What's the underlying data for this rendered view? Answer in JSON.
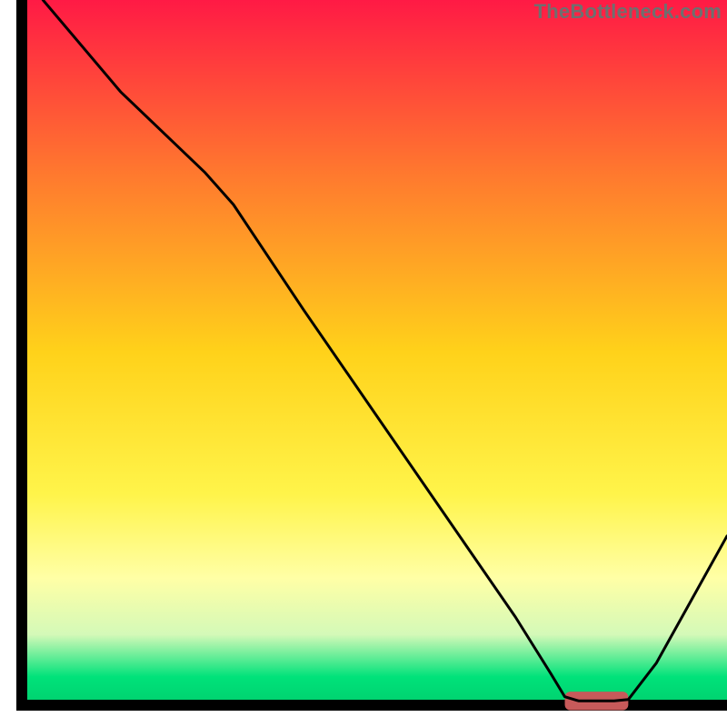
{
  "attribution": "TheBottleneck.com",
  "chart_data": {
    "type": "line",
    "title": "",
    "xlabel": "",
    "ylabel": "",
    "xlim": [
      0,
      100
    ],
    "ylim": [
      0,
      100
    ],
    "background_gradient": {
      "type": "vertical",
      "stops": [
        {
          "pos": 0.0,
          "color": "#ff1a45"
        },
        {
          "pos": 0.25,
          "color": "#ff7a2e"
        },
        {
          "pos": 0.5,
          "color": "#ffd21a"
        },
        {
          "pos": 0.7,
          "color": "#fff44a"
        },
        {
          "pos": 0.82,
          "color": "#ffffa6"
        },
        {
          "pos": 0.9,
          "color": "#d4f9b8"
        },
        {
          "pos": 0.96,
          "color": "#00e27a"
        },
        {
          "pos": 1.0,
          "color": "#00d06e"
        }
      ]
    },
    "frame": {
      "x0": 3,
      "y0": 3,
      "x1": 100,
      "y1": 100,
      "stroke": "#000000",
      "width": 3
    },
    "optimum_marker": {
      "x_start": 77,
      "x_end": 86,
      "y": 0.6,
      "color": "#c75a5a",
      "thickness": 1.6
    },
    "series": [
      {
        "name": "bottleneck-curve",
        "points": [
          {
            "x": 3.0,
            "y": 100.0
          },
          {
            "x": 14.0,
            "y": 87.0
          },
          {
            "x": 26.0,
            "y": 75.5
          },
          {
            "x": 30.0,
            "y": 71.0
          },
          {
            "x": 40.0,
            "y": 56.0
          },
          {
            "x": 50.0,
            "y": 41.5
          },
          {
            "x": 60.0,
            "y": 27.0
          },
          {
            "x": 70.0,
            "y": 12.5
          },
          {
            "x": 75.0,
            "y": 4.5
          },
          {
            "x": 77.0,
            "y": 1.2
          },
          {
            "x": 79.0,
            "y": 0.6
          },
          {
            "x": 84.0,
            "y": 0.6
          },
          {
            "x": 86.0,
            "y": 0.8
          },
          {
            "x": 90.0,
            "y": 6.0
          },
          {
            "x": 95.0,
            "y": 15.0
          },
          {
            "x": 100.0,
            "y": 24.0
          }
        ]
      }
    ]
  }
}
